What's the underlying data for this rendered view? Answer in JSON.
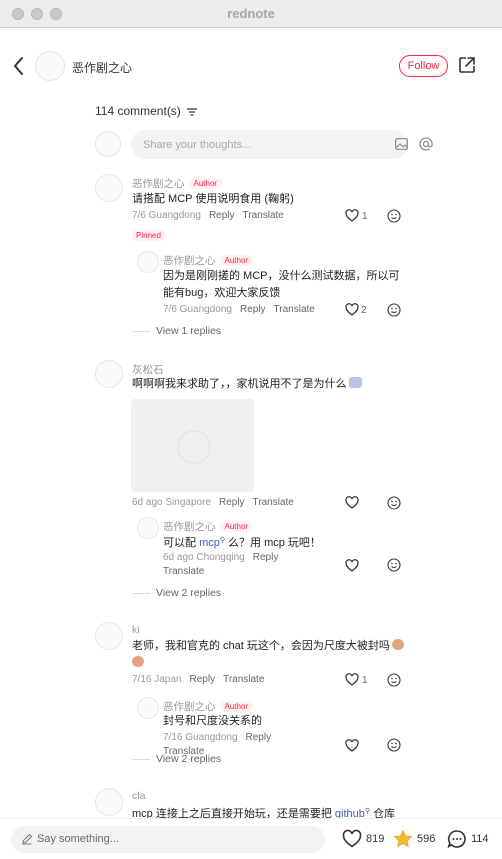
{
  "window": {
    "title": "rednote"
  },
  "header": {
    "author_name": "恶作剧之心",
    "follow_label": "Follow"
  },
  "comments_header": {
    "count_label": "114 comment(s)"
  },
  "input": {
    "placeholder": "Share your thoughts..."
  },
  "labels": {
    "reply": "Reply",
    "translate": "Translate",
    "author": "Author",
    "pinned": "Pinned"
  },
  "comments": [
    {
      "user": "恶作剧之心",
      "text": "请搭配 MCP 使用说明食用 (鞠躬)",
      "meta": "7/6 Guangdong",
      "likes": "1",
      "reply": {
        "user": "恶作剧之心",
        "line1": "因为是刚刚搓的 MCP，没什么测试数据，所以可",
        "line2": "能有bug，欢迎大家反馈",
        "meta": "7/6 Guangdong",
        "likes": "2"
      },
      "view_replies": "View 1 replies"
    },
    {
      "user": "灰松石",
      "text": "啊啊啊我来求助了，，家机说用不了是为什么",
      "meta": "6d ago Singapore",
      "reply": {
        "user": "恶作剧之心",
        "text_before": "可以配 ",
        "link": "mcp",
        "text_after": " 么？用 mcp 玩吧！",
        "meta": "6d ago Chongqing"
      },
      "view_replies": "View 2 replies"
    },
    {
      "user": "ki",
      "line1": "老师，我和官克的 chat 玩这个，会因为尺度大被封吗",
      "meta": "7/16 Japan",
      "likes": "1",
      "reply": {
        "user": "恶作剧之心",
        "text": "封号和尺度没关系的",
        "meta": "7/16 Guangdong"
      },
      "view_replies": "View 2 replies"
    },
    {
      "user": "cla",
      "text_before": "mcp 连接上之后直接开始玩，还是需要把 ",
      "link": "github",
      "text_after": " 仓库"
    }
  ],
  "bottom": {
    "say_placeholder": "Say something...",
    "likes": "819",
    "stars": "596",
    "comments": "114"
  },
  "colors": {
    "accent": "#ff2442",
    "link": "#3b5fa8",
    "star": "#f5b82e"
  }
}
